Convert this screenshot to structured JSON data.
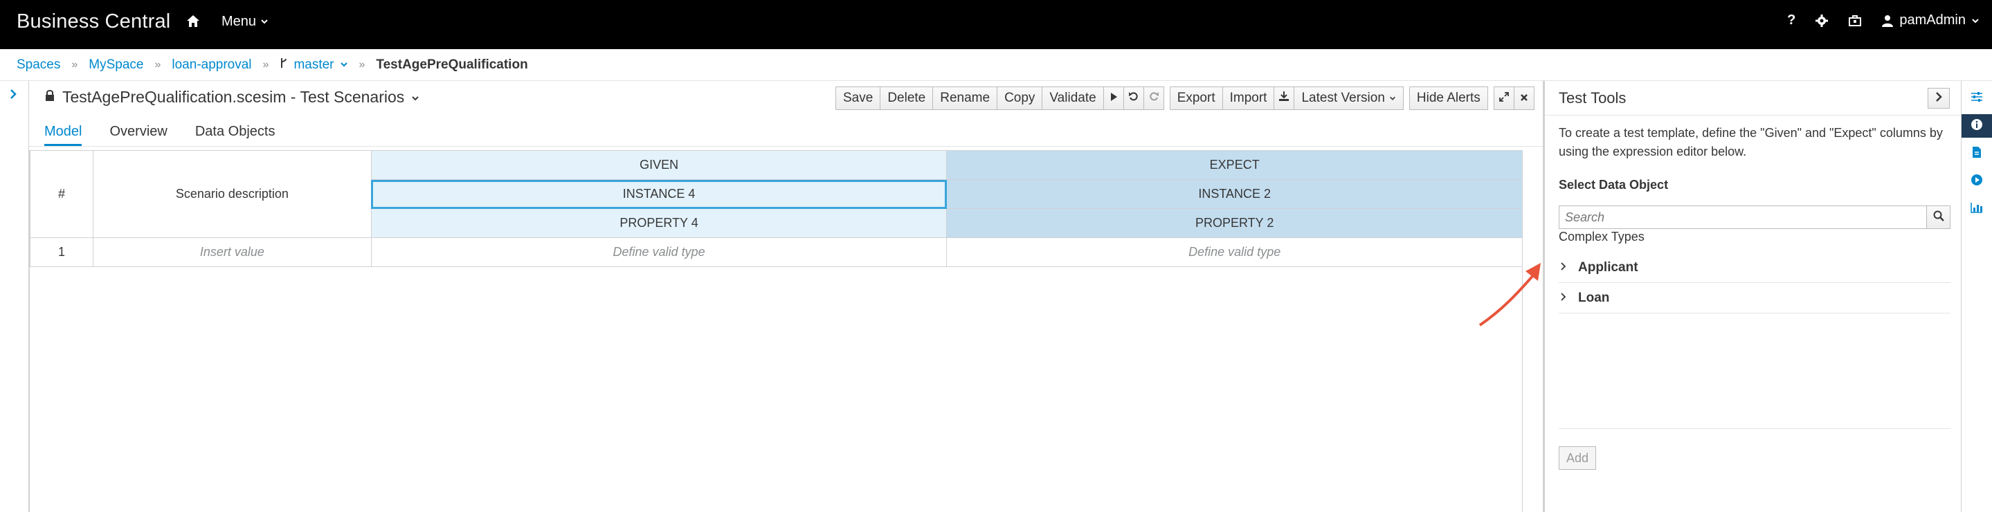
{
  "navbar": {
    "brand": "Business Central",
    "menu_label": "Menu",
    "help_label": "?",
    "user_name": "pamAdmin"
  },
  "breadcrumb": {
    "items": [
      "Spaces",
      "MySpace",
      "loan-approval",
      "master"
    ],
    "current": "TestAgePreQualification"
  },
  "editor": {
    "title": "TestAgePreQualification.scesim - Test Scenarios",
    "toolbar": {
      "save": "Save",
      "delete": "Delete",
      "rename": "Rename",
      "copy": "Copy",
      "validate": "Validate",
      "export": "Export",
      "import": "Import",
      "latest_version": "Latest Version",
      "hide_alerts": "Hide Alerts"
    },
    "tabs": [
      "Model",
      "Overview",
      "Data Objects"
    ],
    "active_tab": "Model"
  },
  "grid": {
    "num_header": "#",
    "desc_header": "Scenario description",
    "given_header": "GIVEN",
    "expect_header": "EXPECT",
    "given_instance": "INSTANCE 4",
    "expect_instance": "INSTANCE 2",
    "given_property": "PROPERTY 4",
    "expect_property": "PROPERTY 2",
    "rows": [
      {
        "num": "1",
        "description": "Insert value",
        "given": "Define valid type",
        "expect": "Define valid type"
      }
    ]
  },
  "test_tools": {
    "title": "Test Tools",
    "description": "To create a test template, define the \"Given\" and \"Expect\" columns by using the expression editor below.",
    "select_label": "Select Data Object",
    "search_placeholder": "Search",
    "complex_types_label": "Complex Types",
    "tree_items": [
      "Applicant",
      "Loan"
    ],
    "add_button": "Add"
  },
  "colors": {
    "navbar_bg": "#000000",
    "link": "#0088ce",
    "given_bg": "#e3f2fb",
    "expect_bg": "#c3ddef",
    "selection": "#39a5dc",
    "arrow": "#e8553b",
    "rail_active": "#1f3b57"
  },
  "icons": {
    "home": "home-icon",
    "gear": "gear-icon",
    "briefcase": "briefcase-icon",
    "user": "user-icon",
    "lock": "lock-icon",
    "play": "play-icon",
    "undo": "undo-icon",
    "redo": "redo-icon",
    "download": "download-icon",
    "expand": "expand-icon",
    "close": "close-icon",
    "search": "search-icon",
    "sliders": "sliders-icon",
    "info": "info-icon",
    "document": "document-icon",
    "run": "run-icon",
    "chart": "chart-icon"
  }
}
